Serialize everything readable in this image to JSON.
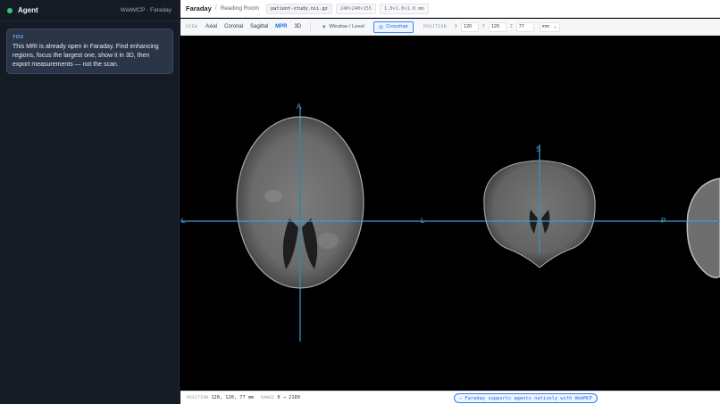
{
  "agent": {
    "title": "Agent",
    "subtitle": "WebMCP · Faraday",
    "message": {
      "from": "YOU",
      "text": "This MRI is already open in Faraday. Find enhancing regions, focus the largest one, show it in 3D, then export measurements — not the scan."
    }
  },
  "topbar": {
    "brand": "Faraday",
    "separator": "/",
    "room": "Reading Room",
    "file": "patient-study.nii.gz",
    "dims": "240×240×155",
    "spacing": "1.0×1.0×1.0 mm"
  },
  "toolbar": {
    "view_label": "VIEW",
    "views": [
      "Axial",
      "Coronal",
      "Sagittal",
      "MPR",
      "3D"
    ],
    "active_view": "MPR",
    "window_level": "Window / Level",
    "crosshair": "Crosshair",
    "position_label": "POSITION",
    "x_label": "X",
    "x": "120",
    "y_label": "Y",
    "y": "120",
    "z_label": "Z",
    "z": "77",
    "unit": "mm"
  },
  "viewer": {
    "axial": {
      "top": "A",
      "left": "L"
    },
    "coronal": {
      "top": "S",
      "left": "L",
      "right": "P"
    }
  },
  "statusbar": {
    "position_label": "POSITION",
    "position": "120, 120, 77 mm",
    "range_label": "RANGE",
    "range": "0 → 2189",
    "badge": "Faraday supports agents natively with WebMCP"
  },
  "colors": {
    "accent": "#1f6fe5",
    "crosshair": "#3c9fd6",
    "agent_panel_bg": "#151b25",
    "status_dot": "#2ecc71"
  },
  "icons": [
    "status-dot",
    "window-level-icon",
    "crosshair-icon",
    "chevron-down-icon",
    "sparkle-icon"
  ]
}
